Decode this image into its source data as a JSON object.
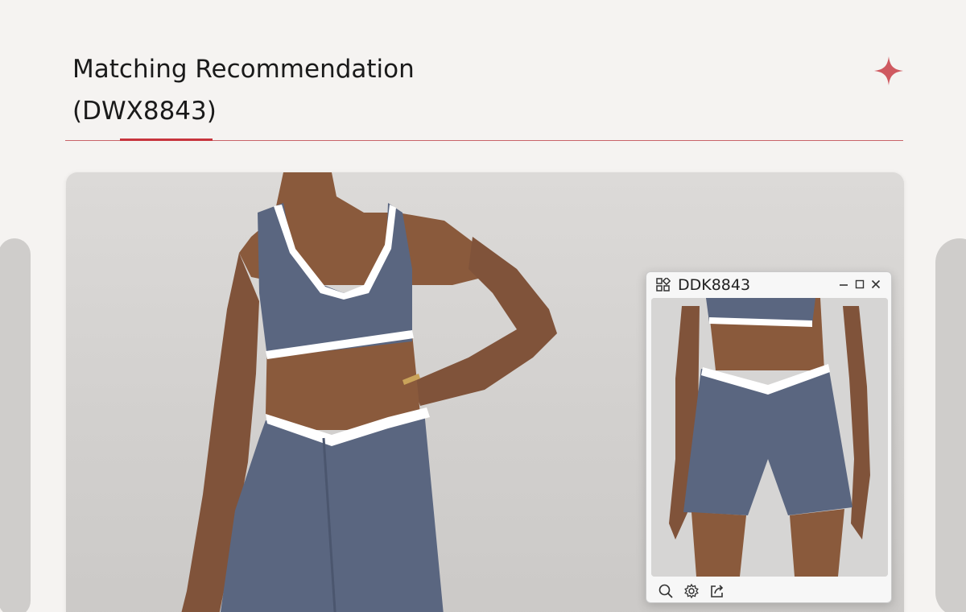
{
  "header": {
    "title_line1": "Matching Recommendation",
    "title_line2": "(DWX8843)",
    "accent_color": "#c7343c"
  },
  "popup": {
    "title": "DDK8843",
    "icons": [
      "apps-icon",
      "minimize-icon",
      "maximize-icon",
      "close-icon"
    ],
    "toolbar_icons": [
      "zoom-icon",
      "gear-icon",
      "share-icon"
    ]
  },
  "colors": {
    "background": "#f5f3f1",
    "garment": "#5a6680",
    "trim": "#ffffff",
    "skin": "#8a5a3c"
  }
}
